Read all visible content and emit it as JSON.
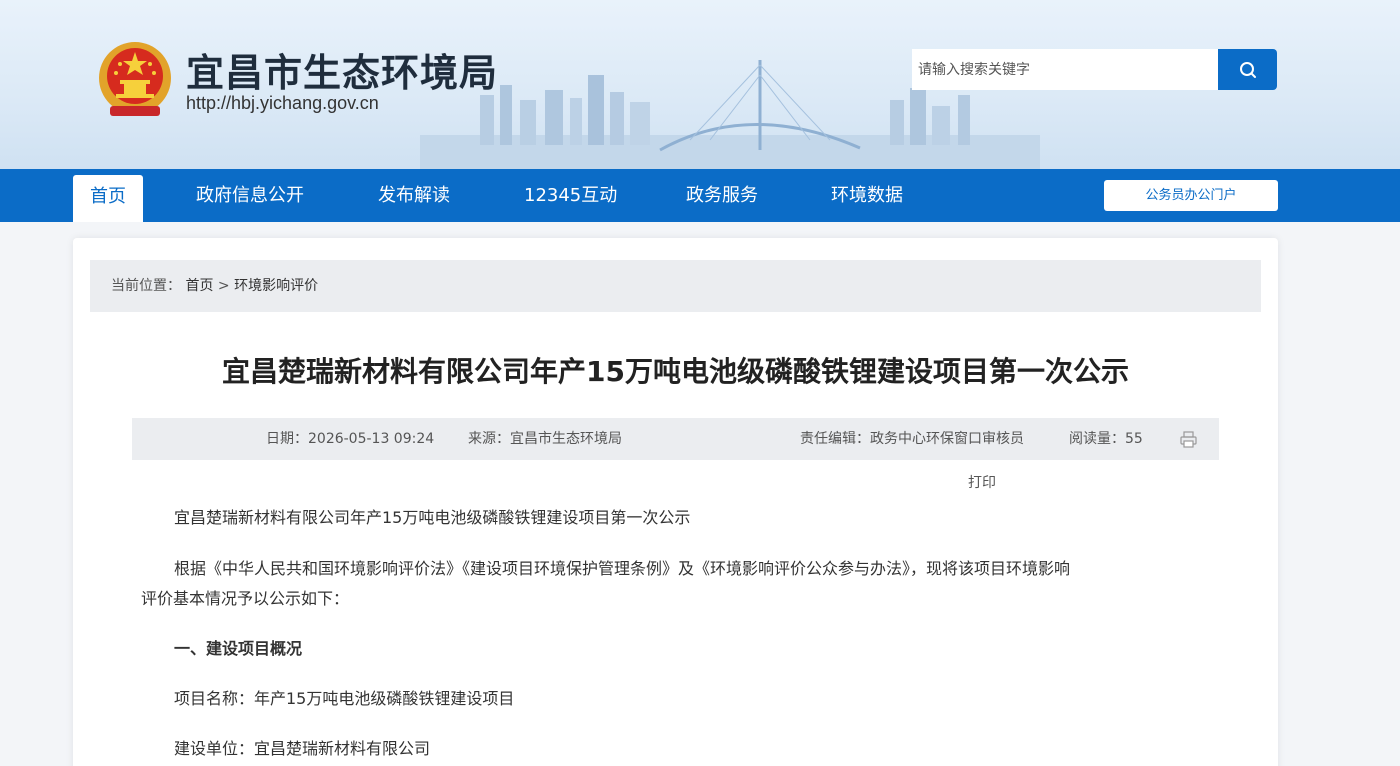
{
  "header": {
    "site_title": "宜昌市生态环境局",
    "site_url": "http://hbj.yichang.gov.cn",
    "search_placeholder": "请输入搜索关键字"
  },
  "nav": {
    "items": [
      "首页",
      "政府信息公开",
      "发布解读",
      "12345互动",
      "政务服务",
      "环境数据"
    ],
    "active": "首页",
    "portal_label": "公务员办公门户"
  },
  "breadcrumb": {
    "prefix": "当前位置：",
    "home": "首页",
    "separator": ">",
    "current": "环境影响评价"
  },
  "article": {
    "title": "宜昌楚瑞新材料有限公司年产15万吨电池级磷酸铁锂建设项目第一次公示",
    "date": "日期：2026-05-13 09:24",
    "source": "来源：宜昌市生态环境局",
    "editor": "责任编辑：政务中心环保窗口审核员",
    "views": "阅读量：55",
    "print_label": "打印",
    "paragraphs": [
      "宜昌楚瑞新材料有限公司年产15万吨电池级磷酸铁锂建设项目第一次公示",
      "根据《中华人民共和国环境影响评价法》《建设项目环境保护管理条例》及《环境影响评价公众参与办法》，现将该项目环境影响",
      "评价基本情况予以公示如下：",
      "一、建设项目概况",
      "项目名称：年产15万吨电池级磷酸铁锂建设项目",
      "建设单位：宜昌楚瑞新材料有限公司"
    ]
  },
  "colors": {
    "primary": "#0b6cc7",
    "meta_bg": "#ebedf0"
  }
}
